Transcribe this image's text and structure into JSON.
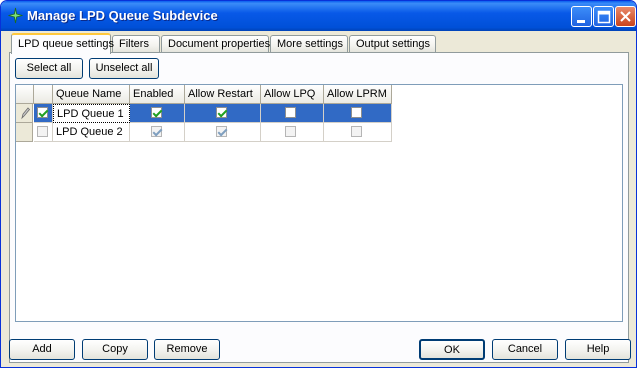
{
  "window": {
    "title": "Manage LPD Queue Subdevice"
  },
  "tabs": [
    {
      "label": "LPD queue settings",
      "active": true
    },
    {
      "label": "Filters",
      "active": false
    },
    {
      "label": "Document properties",
      "active": false
    },
    {
      "label": "More settings",
      "active": false
    },
    {
      "label": "Output settings",
      "active": false
    }
  ],
  "toolbar": {
    "select_all": "Select all",
    "unselect_all": "Unselect all"
  },
  "grid": {
    "columns": [
      "Queue Name",
      "Enabled",
      "Allow Restart",
      "Allow LPQ",
      "Allow LPRM"
    ],
    "rows": [
      {
        "selected": true,
        "row_checked": true,
        "queue_name": "LPD Queue 1",
        "enabled": true,
        "allow_restart": true,
        "allow_lpq": false,
        "allow_lprm": false
      },
      {
        "selected": false,
        "row_checked": false,
        "queue_name": "LPD Queue 2",
        "enabled": true,
        "allow_restart": true,
        "allow_lpq": false,
        "allow_lprm": false
      }
    ]
  },
  "buttons": {
    "add": "Add",
    "copy": "Copy",
    "remove": "Remove",
    "ok": "OK",
    "cancel": "Cancel",
    "help": "Help"
  },
  "icons": {
    "app": "app-star-icon",
    "minimize": "minimize-icon",
    "maximize": "maximize-icon",
    "close": "close-icon",
    "edit_row": "pencil-icon"
  },
  "colors": {
    "titlebar": "#0050D8",
    "selection": "#316AC5",
    "window_bg": "#ECE9D8",
    "active_tab_accent": "#FFC83C"
  }
}
